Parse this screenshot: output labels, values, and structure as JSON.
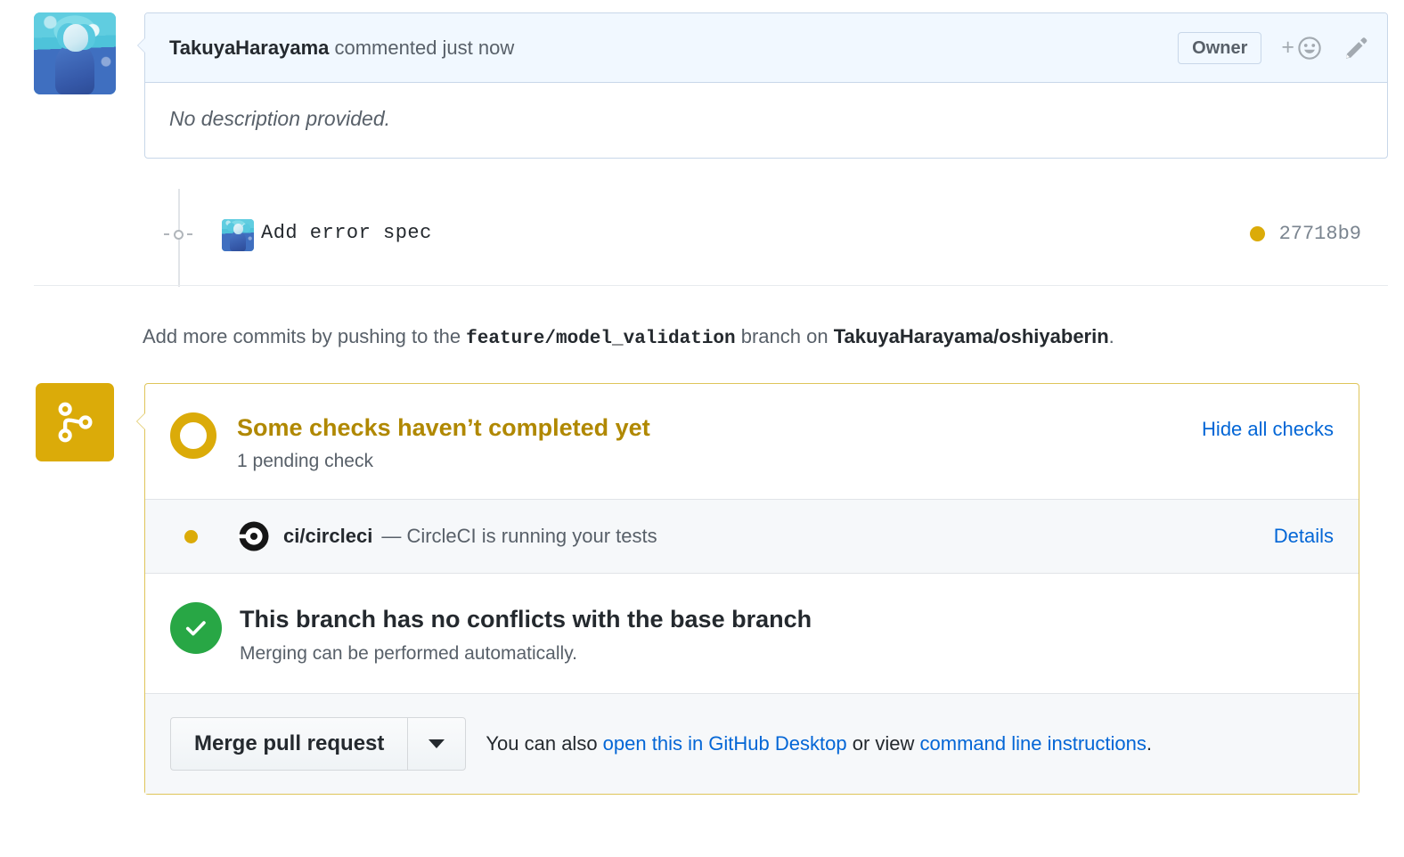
{
  "comment": {
    "author": "TakuyaHarayama",
    "action_text": " commented just now",
    "owner_badge": "Owner",
    "reaction_icon": "smiley-plus-icon",
    "edit_icon": "pencil-icon",
    "body": "No description provided."
  },
  "commit": {
    "message": "Add error spec",
    "sha": "27718b9",
    "status": "pending"
  },
  "push_hint": {
    "prefix": "Add more commits by pushing to the ",
    "branch": "feature/model_validation",
    "middle": " branch on ",
    "repo": "TakuyaHarayama/oshiyaberin",
    "suffix": "."
  },
  "merge_box": {
    "badge_icon": "git-branch-icon",
    "status": {
      "title": "Some checks haven’t completed yet",
      "subtitle": "1 pending check",
      "toggle_label": "Hide all checks",
      "icon": "pending-ring-icon"
    },
    "checks": [
      {
        "name": "ci/circleci",
        "separator": "—",
        "description": "CircleCI is running your tests",
        "details_label": "Details",
        "state": "pending",
        "icon": "circleci-icon"
      }
    ],
    "conflict": {
      "title": "This branch has no conflicts with the base branch",
      "subtitle": "Merging can be performed automatically.",
      "icon": "check-circle-icon"
    },
    "footer": {
      "merge_button": "Merge pull request",
      "dropdown_icon": "chevron-down-icon",
      "text_before": "You can also ",
      "link_desktop": "open this in GitHub Desktop",
      "text_middle": " or view ",
      "link_cli": "command line instructions",
      "text_after": "."
    }
  },
  "colors": {
    "pending": "#dbab09",
    "pending_text": "#b08800",
    "success": "#28a745",
    "link": "#0366d6",
    "border_blue": "#c8d7e9",
    "header_blue": "#f1f8ff",
    "border_gold": "#dfc55a"
  }
}
